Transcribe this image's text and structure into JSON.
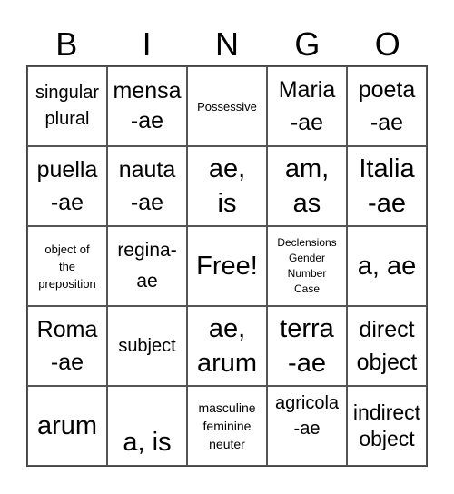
{
  "header": {
    "letters": [
      "B",
      "I",
      "N",
      "G",
      "O"
    ]
  },
  "cells": [
    [
      "singular\nplural",
      "mensa\n-ae",
      "Possessive",
      "Maria\n-ae",
      "poeta\n-ae"
    ],
    [
      "puella\n-ae",
      "nauta\n-ae",
      "ae,\nis",
      "am,\nas",
      "Italia\n-ae"
    ],
    [
      "object of\nthe\npreposition",
      "regina-\nae",
      "Free!",
      "Declensions\nGender\nNumber\nCase",
      "a, ae"
    ],
    [
      "Roma\n-ae",
      "subject",
      "ae,\narum",
      "terra\n-ae",
      "direct\nobject"
    ],
    [
      "arum",
      "a, is",
      "masculine\nfeminine\nneuter",
      "agricola\n-ae",
      "indirect\nobject"
    ]
  ]
}
